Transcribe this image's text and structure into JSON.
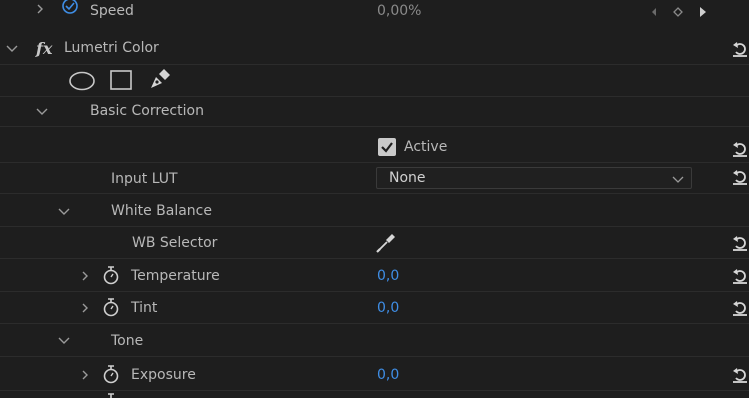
{
  "speed_row": {
    "label": "Speed",
    "value": "0,00%"
  },
  "effect": {
    "fx_label": "fx",
    "name": "Lumetri Color"
  },
  "mask_tools": {
    "ellipse": "ellipse-mask-icon",
    "rectangle": "rectangle-mask-icon",
    "pen": "pen-mask-icon"
  },
  "basic_correction": {
    "title": "Basic Correction",
    "active_label": "Active",
    "active_checked": true,
    "input_lut": {
      "label": "Input LUT",
      "value": "None"
    },
    "white_balance": {
      "title": "White Balance",
      "wb_selector_label": "WB Selector",
      "temperature": {
        "label": "Temperature",
        "value": "0,0"
      },
      "tint": {
        "label": "Tint",
        "value": "0,0"
      }
    },
    "tone": {
      "title": "Tone",
      "exposure": {
        "label": "Exposure",
        "value": "0,0"
      }
    }
  },
  "colors": {
    "value_blue": "#3f8ee6",
    "background": "#1e1e1e",
    "text": "#b8b8b8"
  }
}
